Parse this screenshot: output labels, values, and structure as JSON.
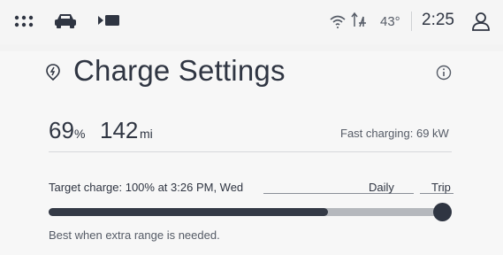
{
  "status_bar": {
    "icons": [
      "apps-grid-icon",
      "car-icon",
      "media-icon",
      "wifi-icon",
      "cellular-signal-icon",
      "profile-icon"
    ],
    "temperature": "43°",
    "clock": "2:25"
  },
  "charge_settings": {
    "title": "Charge Settings",
    "title_icon": "charge-location-icon",
    "info_icon": "info-icon",
    "battery_percent": "69",
    "battery_percent_unit": "%",
    "range_value": "142",
    "range_unit": "mi",
    "fast_charging": "Fast charging: 69 kW",
    "target_charge": "Target charge: 100% at 3:26 PM, Wed",
    "daily_label": "Daily",
    "trip_label": "Trip",
    "slider_current_fraction": 0.71,
    "slider_target_fraction": 1.0,
    "hint": "Best when extra range is needed."
  },
  "colors": {
    "background": "#f3f3f3",
    "text_primary": "#2f3542",
    "text_secondary": "#555b66",
    "slider_fill": "#343a46",
    "slider_track": "#b5b8bd"
  }
}
